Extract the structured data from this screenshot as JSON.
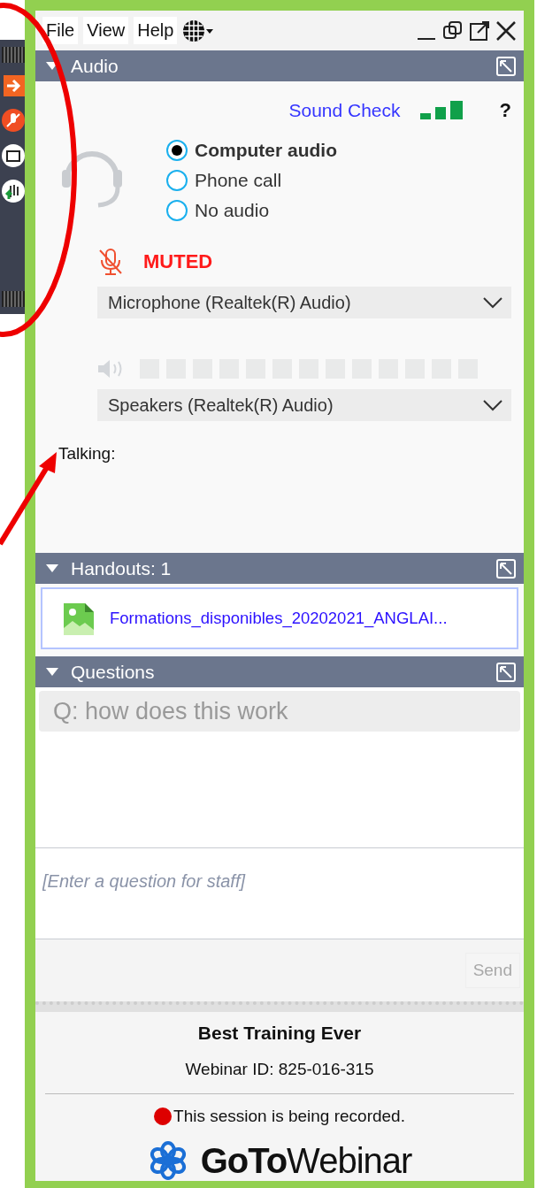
{
  "menu": [
    {
      "label": "File"
    },
    {
      "label": "View"
    },
    {
      "label": "Help"
    }
  ],
  "audio": {
    "title": "Audio",
    "expanded": true,
    "sound_check": "Sound Check",
    "help": "?",
    "options": [
      {
        "label": "Computer audio",
        "selected": true
      },
      {
        "label": "Phone call",
        "selected": false
      },
      {
        "label": "No audio",
        "selected": false
      }
    ],
    "mute_status": "MUTED",
    "microphone": "Microphone (Realtek(R) Audio)",
    "speaker_level": {
      "level": 0
    },
    "speakers": "Speakers (Realtek(R) Audio)",
    "talking": "Talking:"
  },
  "handouts": {
    "title": "Handouts: 1",
    "expanded": true,
    "files": [
      {
        "name": "Formations_disponibles_20202021_ANGLAI..."
      }
    ]
  },
  "questions": {
    "title": "Questions",
    "expanded": true,
    "items": [
      {
        "text": "Q: how does this work"
      }
    ],
    "input": {
      "placeholder": "[Enter a question for staff]"
    },
    "send": {
      "label": "Send",
      "disabled": true
    }
  },
  "footer": {
    "title": "Best Training Ever",
    "webinar_id": "Webinar ID: 825-016-315",
    "recording": "This session is being recorded.",
    "logo": "**GoTo**Webinar"
  }
}
